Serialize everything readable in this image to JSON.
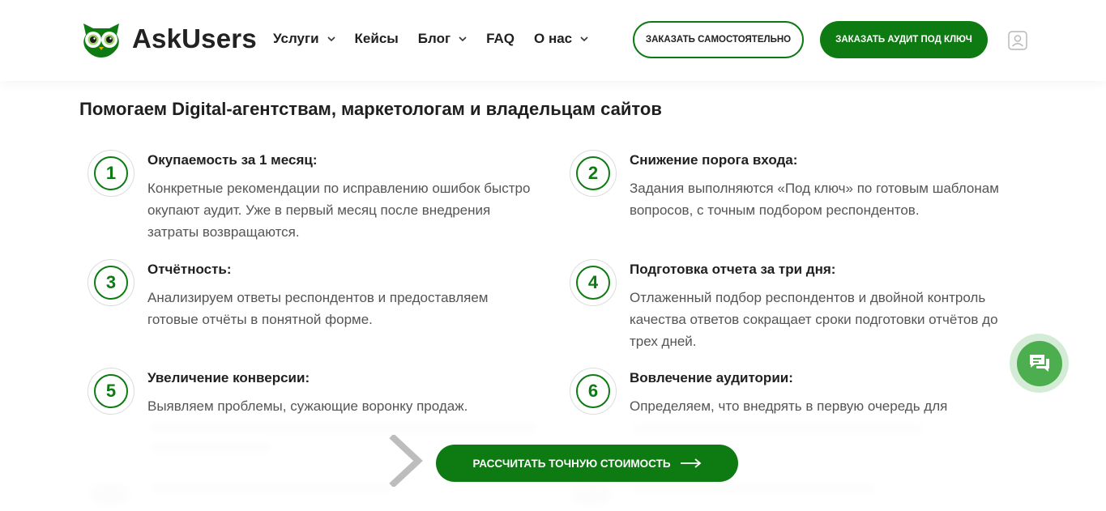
{
  "header": {
    "logo_text": "AskUsers",
    "nav": [
      {
        "label": "Услуги",
        "has_dropdown": true
      },
      {
        "label": "Кейсы",
        "has_dropdown": false
      },
      {
        "label": "Блог",
        "has_dropdown": true
      },
      {
        "label": "FAQ",
        "has_dropdown": false
      },
      {
        "label": "О нас",
        "has_dropdown": true
      }
    ],
    "btn_self_order": "ЗАКАЗАТЬ САМОСТОЯТЕЛЬНО",
    "btn_audit": "ЗАКАЗАТЬ АУДИТ ПОД КЛЮЧ",
    "user_icon": "user-icon"
  },
  "section": {
    "title": "Помогаем Digital-агентствам, маркетологам и владельцам сайтов",
    "features": [
      {
        "num": "1",
        "title": "Окупаемость за 1 месяц:",
        "text": "Конкретные рекомендации по исправлению ошибок быстро окупают аудит. Уже в первый месяц после внедрения затраты возвращаются."
      },
      {
        "num": "2",
        "title": "Снижение порога входа:",
        "text": "Задания выполняются «Под ключ» по готовым шаблонам вопросов, с точным подбором респондентов."
      },
      {
        "num": "3",
        "title": "Отчётность:",
        "text": "Анализируем ответы респондентов и предоставляем готовые отчёты в понятной форме."
      },
      {
        "num": "4",
        "title": "Подготовка отчета за три дня:",
        "text": "Отлаженный подбор респондентов и двойной контроль качества ответов сокращает сроки подготовки отчётов до трех дней."
      },
      {
        "num": "5",
        "title": "Увеличение конверсии:",
        "text": "Выявляем проблемы, сужающие воронку продаж."
      },
      {
        "num": "6",
        "title": "Вовлечение аудитории:",
        "text": "Определяем, что внедрять в первую очередь для"
      }
    ]
  },
  "cta": {
    "label": "РАССЧИТАТЬ ТОЧНУЮ СТОИМОСТЬ"
  },
  "colors": {
    "brand_green": "#0d7a12",
    "chat_green": "#4cae4f"
  }
}
